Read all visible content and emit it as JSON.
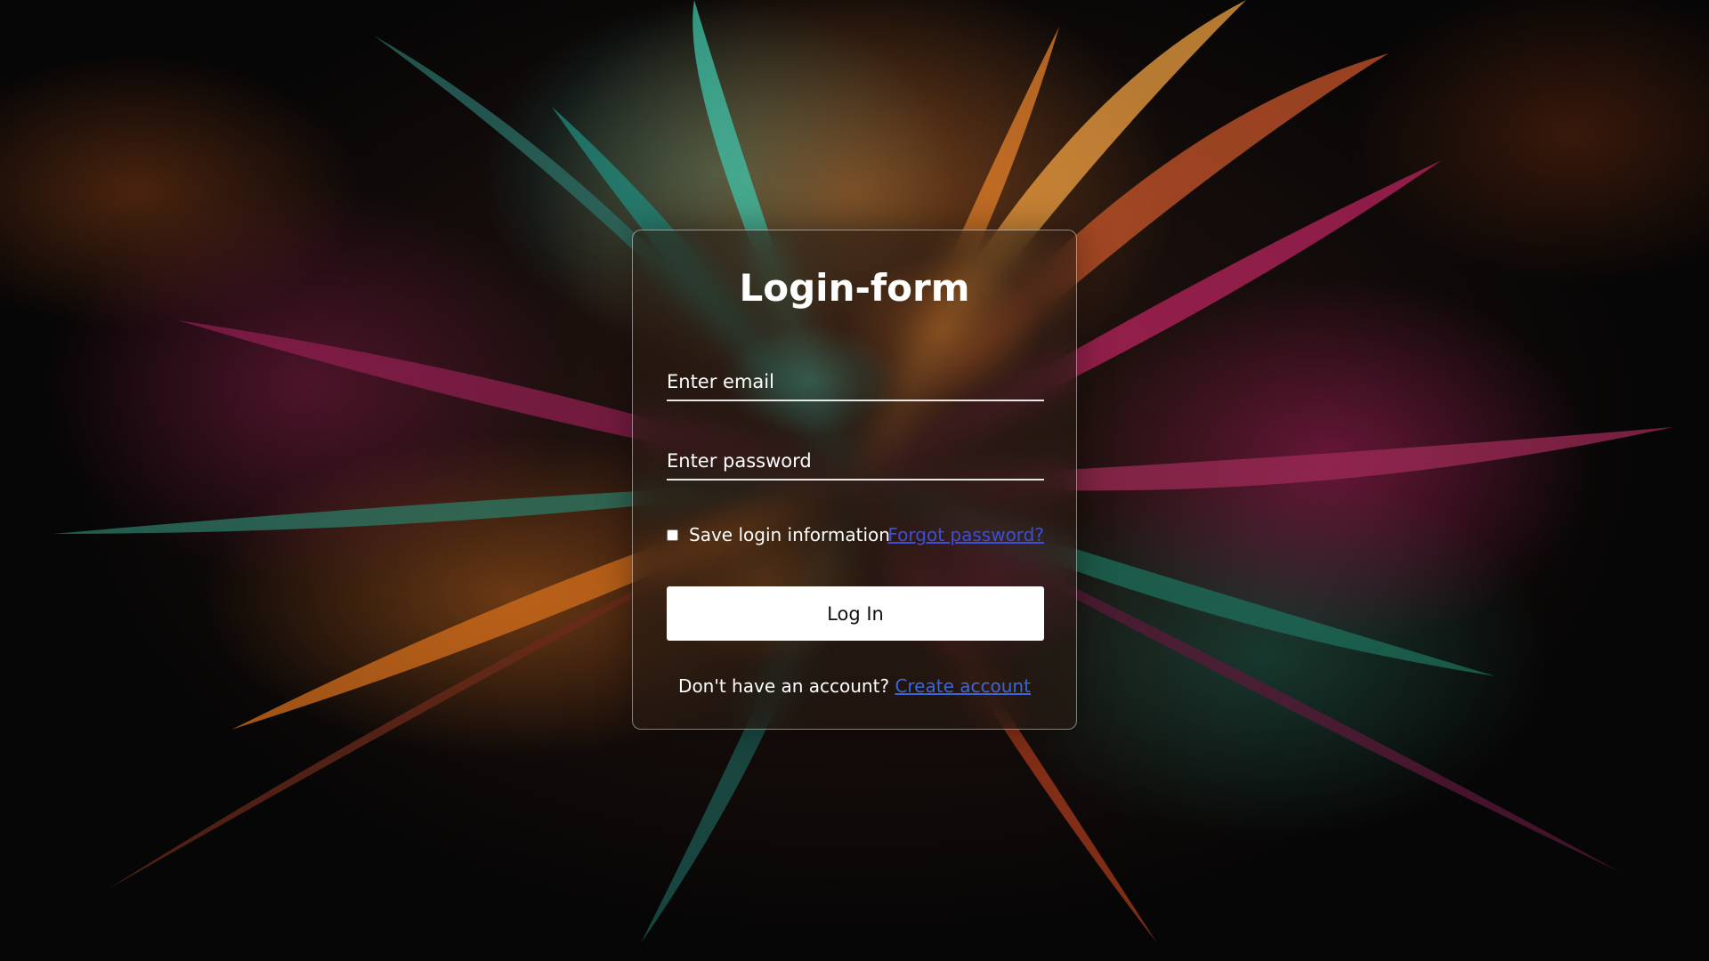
{
  "background": {
    "description_icon": "abstract-feather-wallpaper",
    "colors": [
      "#e07a20",
      "#c0256b",
      "#2f9e8a",
      "#0b0a0a"
    ]
  },
  "form": {
    "title": "Login-form",
    "email_placeholder": "Enter email",
    "email_value": "",
    "password_placeholder": "Enter password",
    "password_value": "",
    "remember_label": "Save login information",
    "remember_checked": false,
    "forgot_link": "Forgot password?",
    "submit_label": "Log In",
    "signup_prompt": "Don't have an account?",
    "signup_link": "Create account",
    "link_color": "#3b4fd8"
  }
}
